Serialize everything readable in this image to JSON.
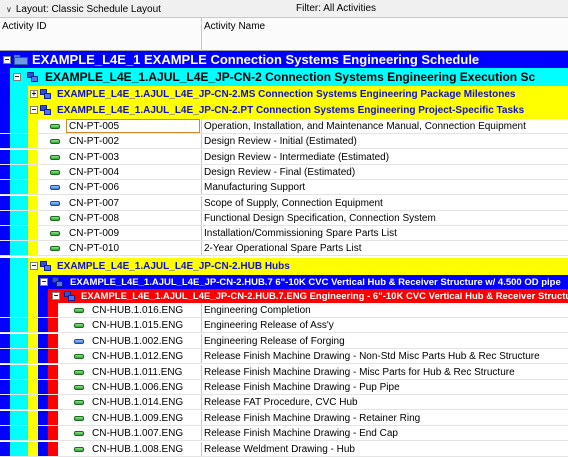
{
  "toolbar": {
    "layout_label": "Layout: Classic Schedule Layout",
    "filter_label": "Filter: All Activities"
  },
  "columns": {
    "activity_id": "Activity ID",
    "activity_name": "Activity Name"
  },
  "wbs": {
    "l1": "EXAMPLE_L4E_1  EXAMPLE Connection Systems Engineering Schedule",
    "l2": "EXAMPLE_L4E_1.AJUL_L4E_JP-CN-2  Connection Systems Engineering Execution Sc",
    "l3_ms": "EXAMPLE_L4E_1.AJUL_L4E_JP-CN-2.MS  Connection Systems Engineering Package Milestones",
    "l3_pt": "EXAMPLE_L4E_1.AJUL_L4E_JP-CN-2.PT  Connection Systems Engineering Project-Specific Tasks",
    "l3_hub": "EXAMPLE_L4E_1.AJUL_L4E_JP-CN-2.HUB  Hubs",
    "l4_hub7": "EXAMPLE_L4E_1.AJUL_L4E_JP-CN-2.HUB.7  6\"-10K CVC Vertical Hub & Receiver Structure w/ 4.500 OD pipe",
    "l5_eng": "EXAMPLE_L4E_1.AJUL_L4E_JP-CN-2.HUB.7.ENG  Engineering - 6\"-10K CVC Vertical Hub & Receiver Structu"
  },
  "colors": {
    "l1_band": "#0000ff",
    "l2_band": "#00ffff",
    "l3_band": "#ffff00",
    "l4_band": "#0000ff",
    "l5_band": "#ff0000",
    "activity_bar_green": "#2fa82f",
    "activity_bar_blue": "#3b7de0",
    "selection_outline": "#d08a2c"
  },
  "pt_activities": [
    {
      "id": "CN-PT-005",
      "name": "Operation, Installation, and Maintenance Manual, Connection Equipment",
      "icon": "green-activity-bar",
      "selected": true
    },
    {
      "id": "CN-PT-002",
      "name": "Design Review - Initial (Estimated)",
      "icon": "green-activity-bar"
    },
    {
      "id": "CN-PT-003",
      "name": "Design Review - Intermediate (Estimated)",
      "icon": "green-activity-bar"
    },
    {
      "id": "CN-PT-004",
      "name": "Design Review - Final (Estimated)",
      "icon": "green-activity-bar"
    },
    {
      "id": "CN-PT-006",
      "name": "Manufacturing Support",
      "icon": "blue-activity-bar"
    },
    {
      "id": "CN-PT-007",
      "name": "Scope of Supply, Connection Equipment",
      "icon": "blue-activity-bar"
    },
    {
      "id": "CN-PT-008",
      "name": "Functional Design Specification, Connection System",
      "icon": "green-activity-bar"
    },
    {
      "id": "CN-PT-009",
      "name": "Installation/Commissioning Spare Parts List",
      "icon": "green-activity-bar"
    },
    {
      "id": "CN-PT-010",
      "name": "2-Year Operational Spare Parts List",
      "icon": "green-activity-bar"
    }
  ],
  "eng_activities": [
    {
      "id": "CN-HUB.1.016.ENG",
      "name": "Engineering Completion",
      "icon": "green-activity-bar"
    },
    {
      "id": "CN-HUB.1.015.ENG",
      "name": "Engineering Release of Ass'y",
      "icon": "green-activity-bar"
    },
    {
      "id": "CN-HUB.1.002.ENG",
      "name": "Engineering Release of Forging",
      "icon": "blue-activity-bar"
    },
    {
      "id": "CN-HUB.1.012.ENG",
      "name": "Release Finish Machine Drawing - Non-Std Misc Parts Hub & Rec Structure",
      "icon": "green-activity-bar"
    },
    {
      "id": "CN-HUB.1.011.ENG",
      "name": "Release Finish Machine Drawing - Misc Parts for Hub & Rec Structure",
      "icon": "green-activity-bar"
    },
    {
      "id": "CN-HUB.1.006.ENG",
      "name": "Release Finish Machine Drawing - Pup Pipe",
      "icon": "green-activity-bar"
    },
    {
      "id": "CN-HUB.1.014.ENG",
      "name": "Release FAT Procedure, CVC Hub",
      "icon": "green-activity-bar"
    },
    {
      "id": "CN-HUB.1.009.ENG",
      "name": "Release Finish Machine Drawing - Retainer Ring",
      "icon": "green-activity-bar"
    },
    {
      "id": "CN-HUB.1.007.ENG",
      "name": "Release Finish Machine Drawing - End Cap",
      "icon": "green-activity-bar"
    },
    {
      "id": "CN-HUB.1.008.ENG",
      "name": "Release Weldment Drawing - Hub",
      "icon": "green-activity-bar"
    }
  ]
}
